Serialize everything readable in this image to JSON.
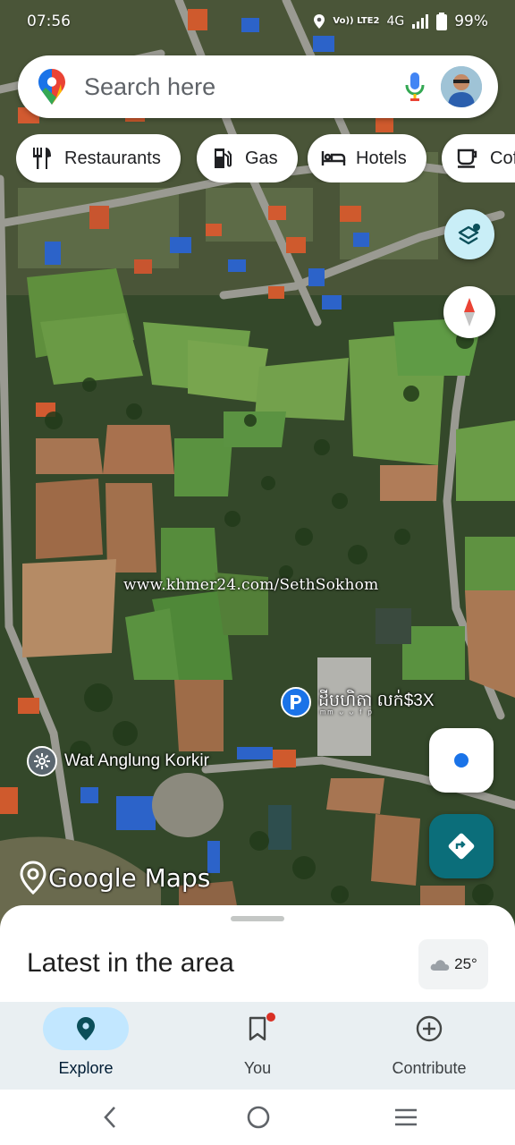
{
  "status_bar": {
    "time": "07:56",
    "network_line1": "Vo)) LTE2",
    "network_type": "4G",
    "battery": "99%"
  },
  "search": {
    "placeholder": "Search here"
  },
  "chips": [
    {
      "label": "Restaurants",
      "icon": "restaurant-icon"
    },
    {
      "label": "Gas",
      "icon": "gas-station-icon"
    },
    {
      "label": "Hotels",
      "icon": "hotel-icon"
    },
    {
      "label": "Coffee",
      "icon": "coffee-icon"
    }
  ],
  "map": {
    "watermark": "www.khmer24.com/SethSokhom",
    "parking_label": "ដីបហិតា លក់$3X",
    "parking_sublabel": "ᵐᵐ ᵕ ᵕ ᶠ ᵖ",
    "wat_label": "Wat Anglung Korkir",
    "logo_text": "Google Maps"
  },
  "sheet": {
    "title": "Latest in the area",
    "temperature": "25°"
  },
  "bottom_nav": [
    {
      "label": "Explore",
      "icon": "explore-pin-icon",
      "active": true
    },
    {
      "label": "You",
      "icon": "bookmark-icon",
      "active": false
    },
    {
      "label": "Contribute",
      "icon": "add-circle-icon",
      "active": false
    }
  ],
  "colors": {
    "accent_teal": "#0b6e7a",
    "explore_pill": "#c2e7ff",
    "my_location": "#1a73e8"
  }
}
